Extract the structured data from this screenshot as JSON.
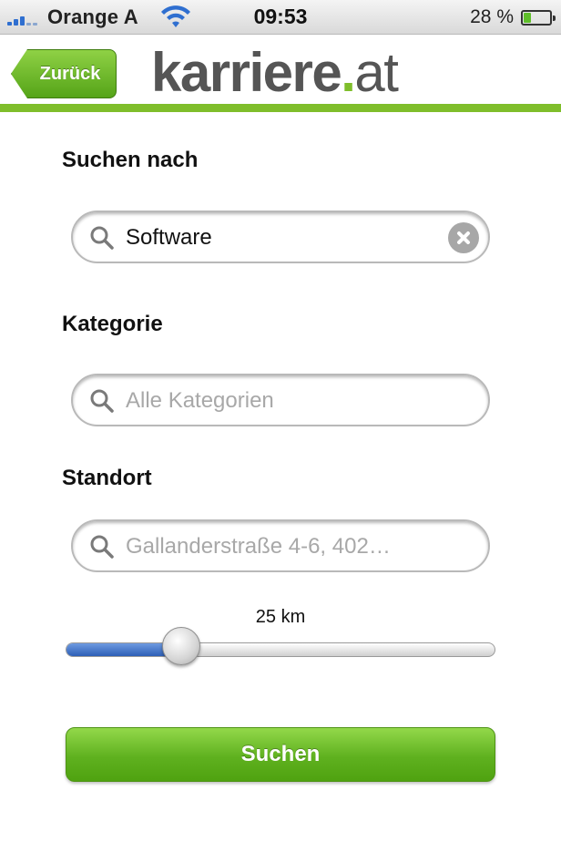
{
  "status_bar": {
    "carrier": "Orange A",
    "time": "09:53",
    "battery_percent": "28 %",
    "battery_level": 0.28
  },
  "header": {
    "back_label": "Zurück",
    "logo_name": "karriere",
    "logo_dot": ".",
    "logo_tld": "at"
  },
  "form": {
    "query": {
      "label": "Suchen nach",
      "value": "Software",
      "placeholder": ""
    },
    "category": {
      "label": "Kategorie",
      "value": "",
      "placeholder": "Alle Kategorien"
    },
    "location": {
      "label": "Standort",
      "value": "",
      "placeholder": "Gallanderstraße 4-6, 402…"
    },
    "radius": {
      "value_text": "25 km",
      "fraction": 0.27
    },
    "submit_label": "Suchen"
  },
  "colors": {
    "brand_green": "#7fbe2b",
    "slider_blue": "#2d5fb6"
  }
}
